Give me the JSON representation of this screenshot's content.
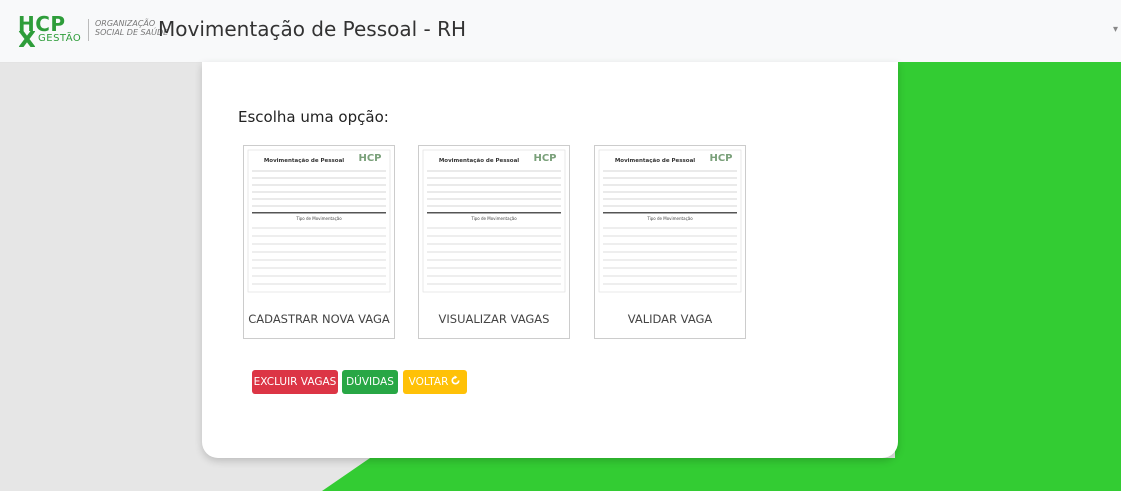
{
  "header": {
    "logo_main": "HCP",
    "logo_sub": "GESTÃO",
    "org_line1": "ORGANIZAÇÃO",
    "org_line2": "SOCIAL DE SAÚDE",
    "title": "Movimentação de Pessoal - RH"
  },
  "main": {
    "heading": "Escolha uma opção:",
    "options": [
      {
        "label": "CADASTRAR NOVA VAGA",
        "thumb_title": "Movimentação de Pessoal",
        "thumb_section": "Tipo de Movimentação"
      },
      {
        "label": "VISUALIZAR VAGAS",
        "thumb_title": "Movimentação de Pessoal",
        "thumb_section": "Tipo de Movimentação"
      },
      {
        "label": "VALIDAR VAGA",
        "thumb_title": "Movimentação de Pessoal",
        "thumb_section": "Tipo de Movimentação"
      }
    ],
    "buttons": {
      "delete": "EXCLUIR VAGAS",
      "help": "DÚVIDAS",
      "back": "VOLTAR"
    }
  },
  "colors": {
    "brand_green": "#2e9d3a",
    "background_green": "#33cc33",
    "danger": "#dc3545",
    "success": "#28a745",
    "warning": "#ffc107"
  },
  "icons": {
    "back": "refresh-icon",
    "menu": "caret-down-icon"
  }
}
